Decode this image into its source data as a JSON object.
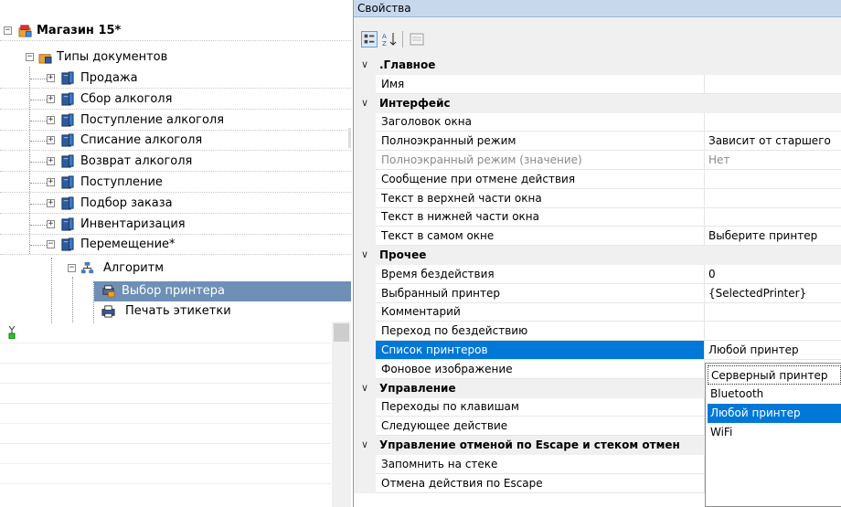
{
  "tree": {
    "root": {
      "label": "Магазин 15*",
      "expander": "−"
    },
    "doc_types": {
      "label": "Типы документов",
      "expander": "−"
    },
    "documents": [
      {
        "label": "Продажа",
        "expander": "+"
      },
      {
        "label": "Сбор алкоголя",
        "expander": "+"
      },
      {
        "label": "Поступление алкоголя",
        "expander": "+"
      },
      {
        "label": "Списание алкоголя",
        "expander": "+"
      },
      {
        "label": "Возврат алкоголя",
        "expander": "+"
      },
      {
        "label": "Поступление",
        "expander": "+"
      },
      {
        "label": "Подбор заказа",
        "expander": "+"
      },
      {
        "label": "Инвентаризация",
        "expander": "+"
      },
      {
        "label": "Перемещение*",
        "expander": "−"
      }
    ],
    "algorithm": {
      "label": "Алгоритм",
      "expander": "−"
    },
    "actions": [
      {
        "label": "Выбор принтера",
        "selected": true
      },
      {
        "label": "Печать этикетки",
        "selected": false
      }
    ]
  },
  "properties": {
    "title": "Свойства",
    "toolbar": {
      "categorized": "categorized-icon",
      "alphabetical": "sort-az-icon",
      "pages": "property-pages-icon"
    },
    "rows": [
      {
        "type": "category",
        "name": ".Главное"
      },
      {
        "type": "prop",
        "name": "Имя",
        "value": ""
      },
      {
        "type": "category",
        "name": "Интерфейс"
      },
      {
        "type": "prop",
        "name": "Заголовок окна",
        "value": ""
      },
      {
        "type": "prop",
        "name": "Полноэкранный режим",
        "value": "Зависит от старшего"
      },
      {
        "type": "prop",
        "name": "Полноэкранный режим (значение)",
        "value": "Нет",
        "dim": true
      },
      {
        "type": "prop",
        "name": "Сообщение при отмене действия",
        "value": ""
      },
      {
        "type": "prop",
        "name": "Текст в верхней части окна",
        "value": ""
      },
      {
        "type": "prop",
        "name": "Текст в нижней части окна",
        "value": ""
      },
      {
        "type": "prop",
        "name": "Текст в самом окне",
        "value": "Выберите принтер"
      },
      {
        "type": "category",
        "name": "Прочее"
      },
      {
        "type": "prop",
        "name": "Время бездействия",
        "value": "0"
      },
      {
        "type": "prop",
        "name": "Выбранный принтер",
        "value": "{SelectedPrinter}"
      },
      {
        "type": "prop",
        "name": "Комментарий",
        "value": ""
      },
      {
        "type": "prop",
        "name": "Переход по бездействию",
        "value": ""
      },
      {
        "type": "prop",
        "name": "Список принтеров",
        "value": "Любой принтер",
        "selected": true
      },
      {
        "type": "prop",
        "name": "Фоновое изображение",
        "value": ""
      },
      {
        "type": "category",
        "name": "Управление"
      },
      {
        "type": "prop",
        "name": "Переходы по клавишам",
        "value": ""
      },
      {
        "type": "prop",
        "name": "Следующее действие",
        "value": ""
      },
      {
        "type": "category",
        "name": "Управление отменой по Escape и стеком отмен"
      },
      {
        "type": "prop",
        "name": "Запомнить на стеке",
        "value": ""
      },
      {
        "type": "prop",
        "name": "Отмена действия по Escape",
        "value": ""
      }
    ],
    "chevron": "∨"
  },
  "dropdown": {
    "options": [
      {
        "label": "Серверный принтер",
        "state": "focus"
      },
      {
        "label": "Bluetooth",
        "state": ""
      },
      {
        "label": "Любой принтер",
        "state": "highlight"
      },
      {
        "label": "WiFi",
        "state": ""
      }
    ]
  },
  "colors": {
    "selection": "#0078d7",
    "title_bar": "#c8d8ec",
    "category_bg": "#f0f0f0"
  }
}
